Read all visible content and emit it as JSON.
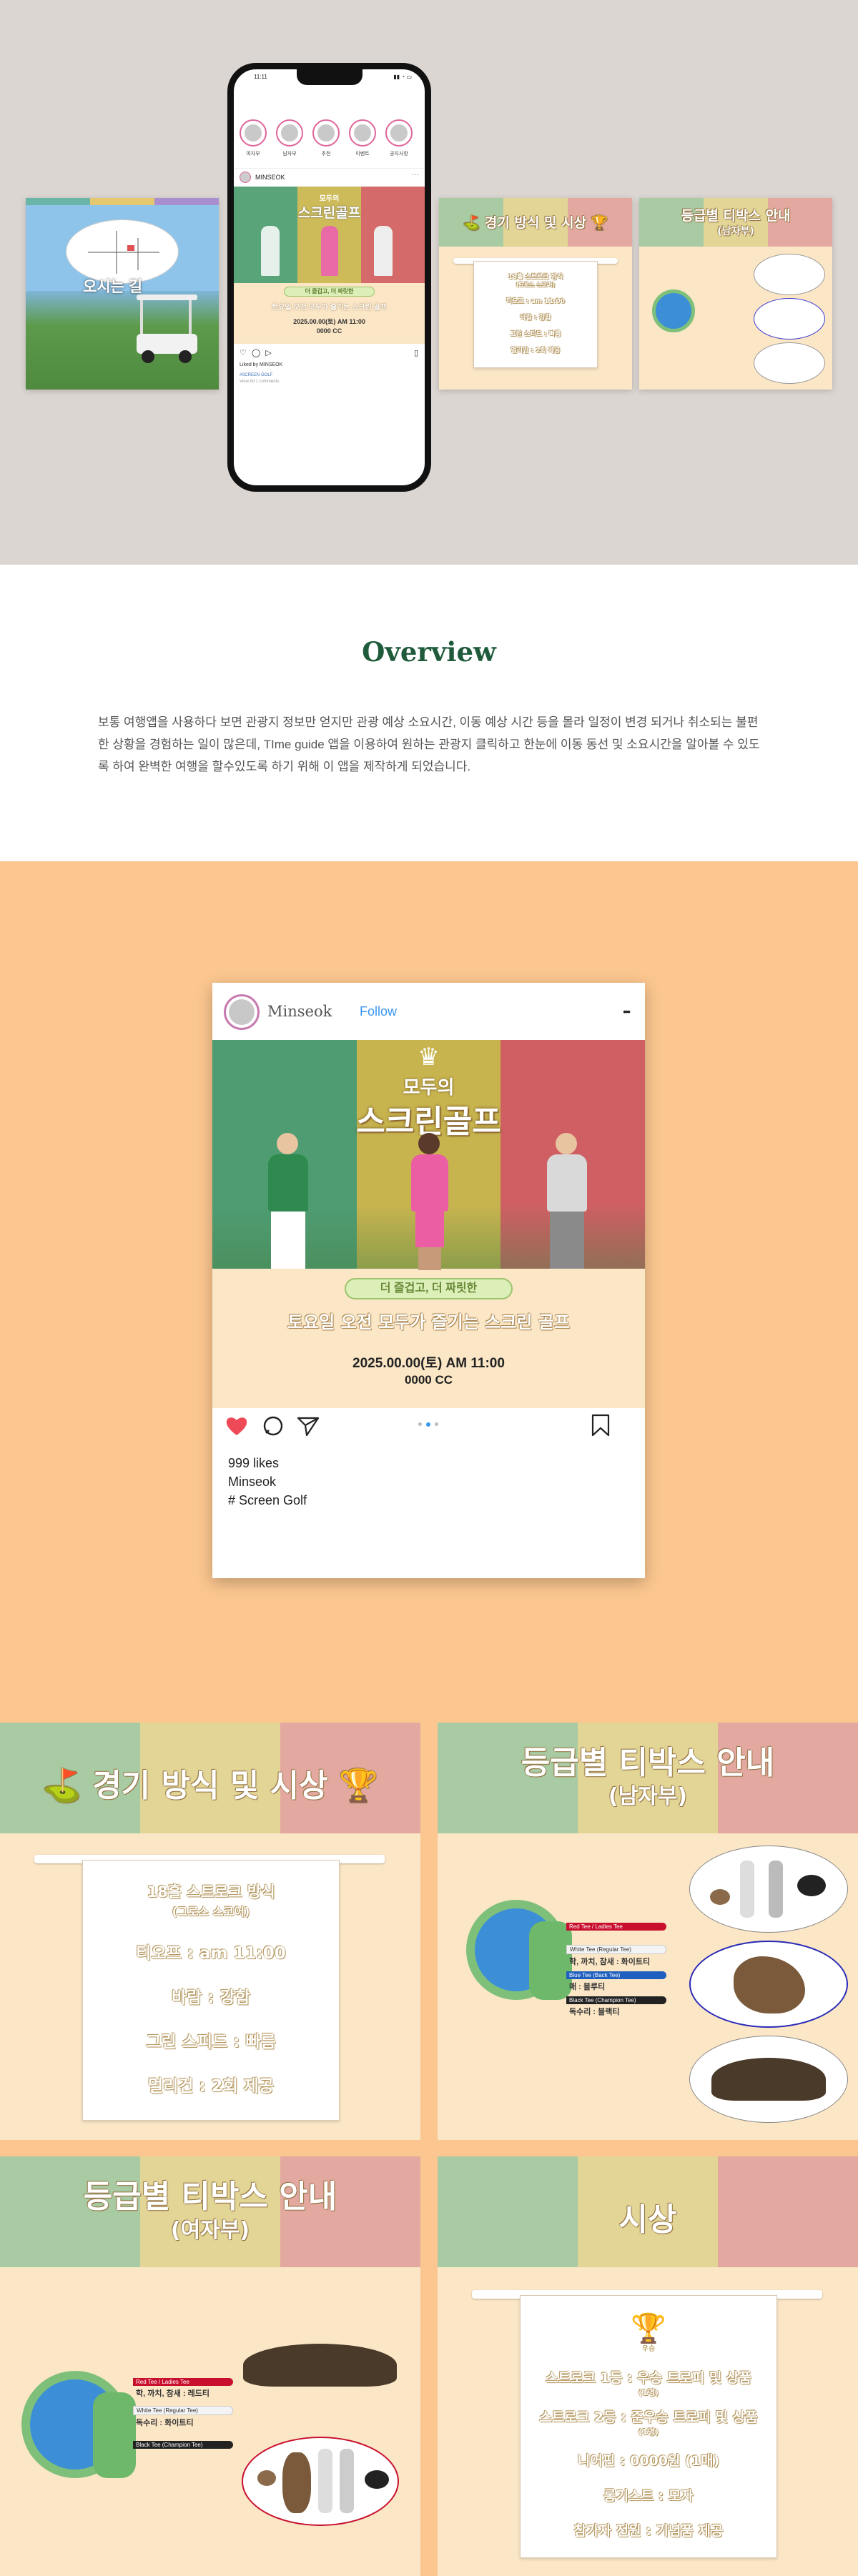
{
  "hero": {
    "map_card": {
      "caption": "오시는 길"
    },
    "phone": {
      "time": "11:11",
      "stories": [
        "여자부",
        "남자부",
        "추천",
        "이벤트",
        "공지사항"
      ],
      "username": "MINSEOK",
      "liked_by": "Liked by MINSEOK",
      "caption_line": "#SCREEN GOLF",
      "comments": "View All 1 comments"
    },
    "rules_card": {
      "title": "경기 방식 및 시상"
    },
    "tee_card": {
      "title": "등급별 티박스 안내",
      "subtitle": "(남자부)"
    }
  },
  "overview": {
    "title": "Overview",
    "text": "보통 여행앱을 사용하다 보면 관광지 정보만 얻지만 관광 예상 소요시간, 이동 예상 시간  등을 몰라 일정이 변경 되거나 취소되는 불편한 상황을 경험하는 일이 많은데, TIme guide 앱을 이용하여 원하는 관광지 클릭하고 한눈에 이동 동선 및 소요시간을  알아볼 수 있도록 하여 완벽한 여행을 할수있도록 하기 위해 이 앱을 제작하게 되었습니다."
  },
  "post": {
    "username": "Minseok",
    "follow": "Follow",
    "more": "•••",
    "poster": {
      "crown": "♛",
      "title_small": "모두의",
      "title_big": "스크린골프",
      "tagline": "더 즐겁고, 더 짜릿한",
      "headline": "토요일 오전 모두가 즐기는 스크린 골프",
      "datetime": "2025.00.00(토) AM 11:00",
      "venue": "0000 CC"
    },
    "likes": "999 likes",
    "author": "Minseok",
    "hashtag": "# Screen Golf"
  },
  "rules": {
    "title": "경기 방식 및 시상",
    "lines": [
      "18홀 스트로크 방식",
      "(그로스 스코어)",
      "티오프 : am 11:00",
      "바람 : 강함",
      "그린 스피드 : 빠름",
      "멀리건 : 2회 제공"
    ]
  },
  "tee_men": {
    "title": "등급별 티박스 안내",
    "subtitle": "(남자부)",
    "tee_labels": [
      "Red Tee / Ladies Tee",
      "White Tee (Regular Tee)",
      "학, 까치, 참새 : 화이트티",
      "Blue Tee (Back Tee)",
      "매 : 블루티",
      "Black Tee (Champion Tee)",
      "독수리 : 블랙티"
    ]
  },
  "tee_women": {
    "title": "등급별 티박스 안내",
    "subtitle": "(여자부)",
    "tee_labels": [
      "Red Tee / Ladies Tee",
      "학, 까치, 참새 : 레드티",
      "White Tee (Regular Tee)",
      "독수리 : 화이트티",
      "Black Tee (Champion Tee)"
    ]
  },
  "awards": {
    "title": "시상",
    "badge": "우승",
    "lines": [
      "스트로크 1등 : 우승 트로피 및 상품",
      "(1명)",
      "스트로크 2등 : 준우승 트로피 및 상품",
      "(1명)",
      "니어핀 : 0000원 (1매)",
      "롱기스트 : 모자",
      "참가자 전원 : 기념품 제공"
    ]
  },
  "colors": {
    "green": "#a8cba3",
    "yellow": "#e2d596",
    "red": "#e3a8a0",
    "cream": "#fbe6c6",
    "peach": "#fbc68f",
    "hero_bg": "#dcd6d2",
    "overview_title": "#1f5b3b",
    "follow_blue": "#3897f0",
    "heart": "#ed4956"
  }
}
